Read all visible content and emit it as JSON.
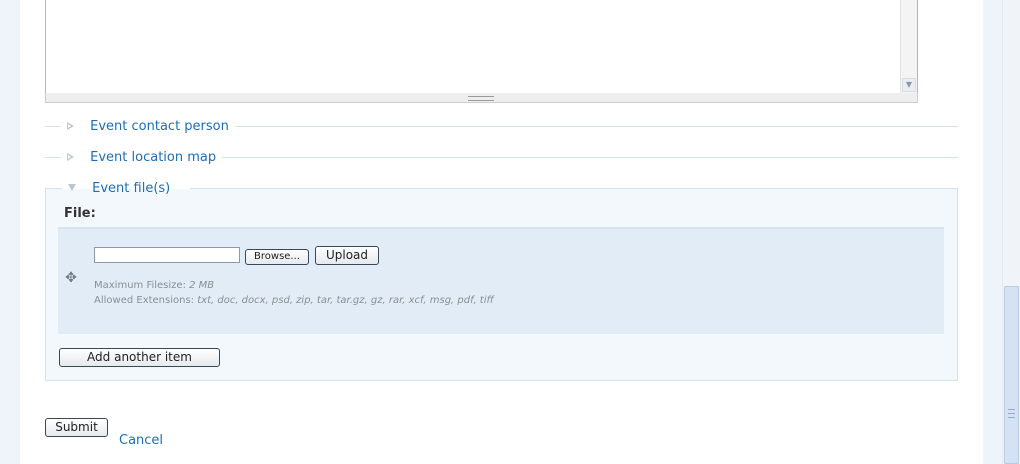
{
  "fieldsets": {
    "contact": {
      "label": "Event contact person"
    },
    "location_map": {
      "label": "Event location map"
    },
    "files": {
      "label": "Event file(s)"
    }
  },
  "file_field": {
    "label": "File:",
    "browse_label": "Browse...",
    "upload_label": "Upload",
    "max_filesize_label": "Maximum Filesize:",
    "max_filesize_value": "2 MB",
    "allowed_ext_label": "Allowed Extensions:",
    "allowed_ext_value": "txt, doc, docx, psd, zip, tar, tar.gz, gz, rar, xcf, msg, pdf, tiff",
    "add_another_label": "Add another item"
  },
  "actions": {
    "submit_label": "Submit",
    "cancel_label": "Cancel"
  },
  "icons": {
    "collapsed": "triangle-right-icon",
    "expanded": "triangle-down-icon",
    "drag": "move-arrows-icon"
  },
  "colors": {
    "link": "#1d6eb4",
    "fieldset_border": "#d1e3ee",
    "row_bg": "#e2ecf6"
  }
}
